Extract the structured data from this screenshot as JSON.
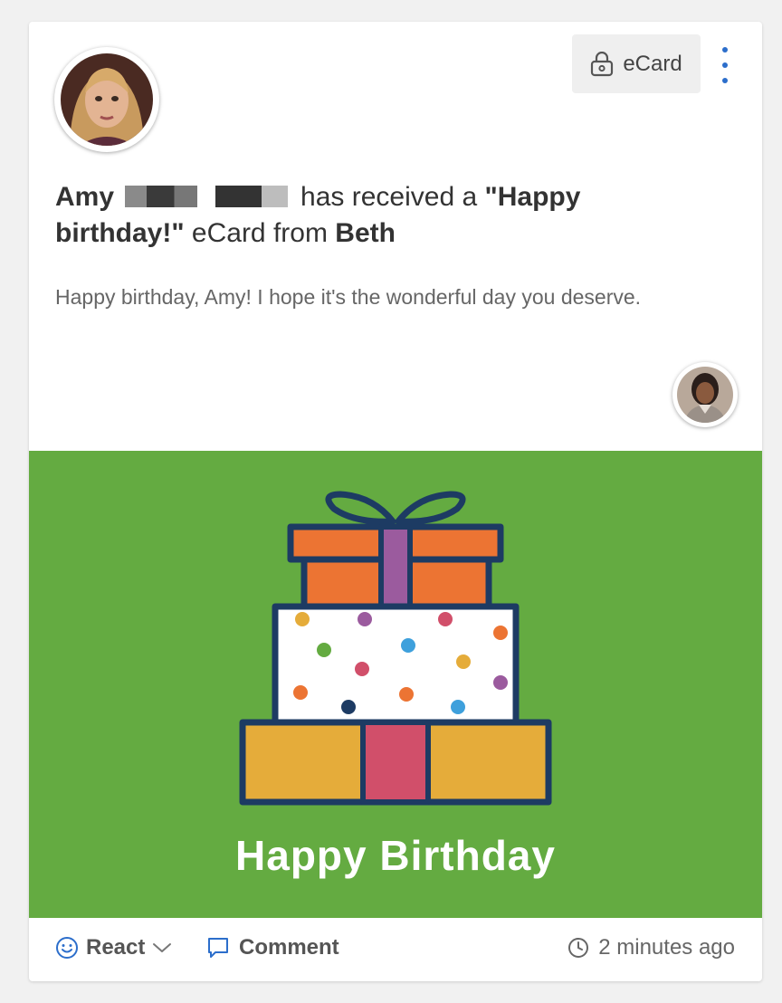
{
  "card": {
    "type_badge": {
      "icon": "lock-icon",
      "label": "eCard"
    },
    "menu_icon": "more-vertical-icon",
    "headline": {
      "recipient_first_name": "Amy",
      "verb_text": "has received a",
      "card_title": "\"Happy birthday!\"",
      "object_text": "eCard from",
      "sender_name": "Beth"
    },
    "message": "Happy birthday, Amy! I hope it's the wonderful day you deserve.",
    "banner": {
      "title": "Happy Birthday",
      "background_color": "#64ab41"
    },
    "footer": {
      "react_label": "React",
      "comment_label": "Comment",
      "timestamp": "2 minutes ago"
    }
  },
  "colors": {
    "accent": "#2c6ecb",
    "gift_outline": "#1d3b63",
    "gift_orange": "#ec7433",
    "gift_purple": "#9b5b9e",
    "gift_yellow": "#e5ac3a",
    "gift_pink": "#d14f6a"
  }
}
